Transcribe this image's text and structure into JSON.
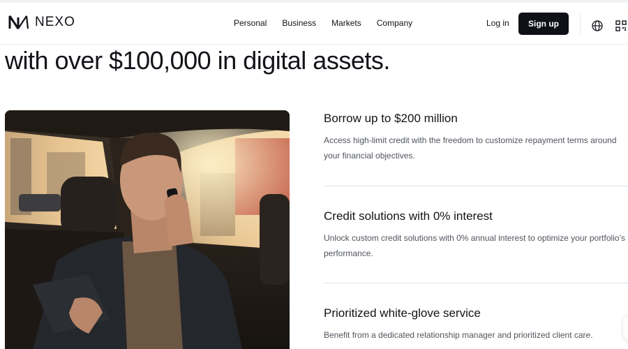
{
  "header": {
    "brand": "NEXO",
    "nav": [
      "Personal",
      "Business",
      "Markets",
      "Company"
    ],
    "login_label": "Log in",
    "signup_label": "Sign up",
    "icons": [
      "nexo-logo-icon",
      "globe-icon",
      "qr-code-icon"
    ]
  },
  "hero": {
    "title": "with over $100,000 in digital assets."
  },
  "features": [
    {
      "title": "Borrow up to $200 million",
      "description": "Access high-limit credit with the freedom to customize repayment terms around your financial objectives."
    },
    {
      "title": "Credit solutions with 0% interest",
      "description": "Unlock custom credit solutions with 0% annual interest to optimize your portfolio’s performance."
    },
    {
      "title": "Prioritized white-glove service",
      "description": "Benefit from a dedicated relationship manager and prioritized client care."
    }
  ],
  "colors": {
    "text": "#111318",
    "muted": "#4f545c",
    "button_bg": "#0f1117",
    "divider": "#dfe2e6"
  }
}
